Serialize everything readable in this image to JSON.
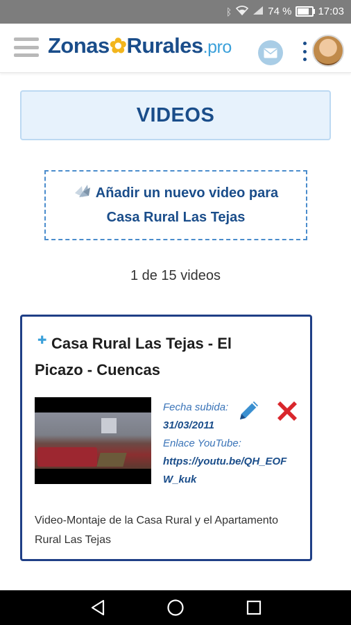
{
  "status_bar": {
    "battery": "74 %",
    "time": "17:03",
    "icons": [
      "bluetooth-icon",
      "wifi-icon",
      "signal-icon",
      "battery-icon"
    ]
  },
  "app_bar": {
    "logo_left": "Zonas",
    "logo_right": "Rurales",
    "logo_suffix": ".pro",
    "icons": [
      "menu-icon",
      "mail-icon",
      "more-vertical-icon",
      "avatar"
    ]
  },
  "page": {
    "title": "VIDEOS",
    "add_line1": "Añadir un nuevo video para",
    "add_line2": "Casa Rural Las Tejas",
    "count": "1 de 15 videos"
  },
  "video": {
    "title": "Casa Rural Las Tejas - El Picazo - Cuencas",
    "date_label": "Fecha subida:",
    "date": "31/03/2011",
    "youtube_label": "Enlace YouTube:",
    "youtube_link": "https://youtu.be/QH_EOFW_kuk",
    "description": "Video-Montaje de la Casa Rural y el Apartamento Rural Las Tejas"
  },
  "colors": {
    "brand": "#1a4d8a",
    "accent": "#3aa0da",
    "card_border": "#1f3f86",
    "delete": "#d9262c"
  }
}
